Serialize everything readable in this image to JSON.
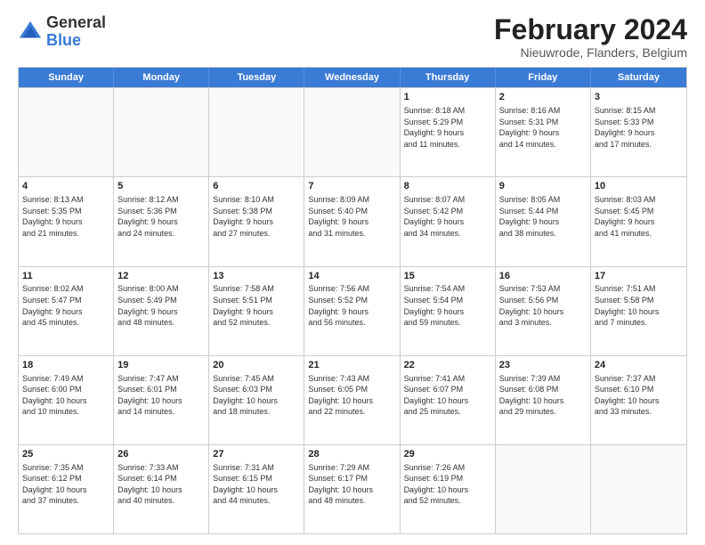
{
  "logo": {
    "general": "General",
    "blue": "Blue"
  },
  "header": {
    "title": "February 2024",
    "location": "Nieuwrode, Flanders, Belgium"
  },
  "days": [
    "Sunday",
    "Monday",
    "Tuesday",
    "Wednesday",
    "Thursday",
    "Friday",
    "Saturday"
  ],
  "weeks": [
    [
      {
        "day": "",
        "text": ""
      },
      {
        "day": "",
        "text": ""
      },
      {
        "day": "",
        "text": ""
      },
      {
        "day": "",
        "text": ""
      },
      {
        "day": "1",
        "text": "Sunrise: 8:18 AM\nSunset: 5:29 PM\nDaylight: 9 hours\nand 11 minutes."
      },
      {
        "day": "2",
        "text": "Sunrise: 8:16 AM\nSunset: 5:31 PM\nDaylight: 9 hours\nand 14 minutes."
      },
      {
        "day": "3",
        "text": "Sunrise: 8:15 AM\nSunset: 5:33 PM\nDaylight: 9 hours\nand 17 minutes."
      }
    ],
    [
      {
        "day": "4",
        "text": "Sunrise: 8:13 AM\nSunset: 5:35 PM\nDaylight: 9 hours\nand 21 minutes."
      },
      {
        "day": "5",
        "text": "Sunrise: 8:12 AM\nSunset: 5:36 PM\nDaylight: 9 hours\nand 24 minutes."
      },
      {
        "day": "6",
        "text": "Sunrise: 8:10 AM\nSunset: 5:38 PM\nDaylight: 9 hours\nand 27 minutes."
      },
      {
        "day": "7",
        "text": "Sunrise: 8:09 AM\nSunset: 5:40 PM\nDaylight: 9 hours\nand 31 minutes."
      },
      {
        "day": "8",
        "text": "Sunrise: 8:07 AM\nSunset: 5:42 PM\nDaylight: 9 hours\nand 34 minutes."
      },
      {
        "day": "9",
        "text": "Sunrise: 8:05 AM\nSunset: 5:44 PM\nDaylight: 9 hours\nand 38 minutes."
      },
      {
        "day": "10",
        "text": "Sunrise: 8:03 AM\nSunset: 5:45 PM\nDaylight: 9 hours\nand 41 minutes."
      }
    ],
    [
      {
        "day": "11",
        "text": "Sunrise: 8:02 AM\nSunset: 5:47 PM\nDaylight: 9 hours\nand 45 minutes."
      },
      {
        "day": "12",
        "text": "Sunrise: 8:00 AM\nSunset: 5:49 PM\nDaylight: 9 hours\nand 48 minutes."
      },
      {
        "day": "13",
        "text": "Sunrise: 7:58 AM\nSunset: 5:51 PM\nDaylight: 9 hours\nand 52 minutes."
      },
      {
        "day": "14",
        "text": "Sunrise: 7:56 AM\nSunset: 5:52 PM\nDaylight: 9 hours\nand 56 minutes."
      },
      {
        "day": "15",
        "text": "Sunrise: 7:54 AM\nSunset: 5:54 PM\nDaylight: 9 hours\nand 59 minutes."
      },
      {
        "day": "16",
        "text": "Sunrise: 7:53 AM\nSunset: 5:56 PM\nDaylight: 10 hours\nand 3 minutes."
      },
      {
        "day": "17",
        "text": "Sunrise: 7:51 AM\nSunset: 5:58 PM\nDaylight: 10 hours\nand 7 minutes."
      }
    ],
    [
      {
        "day": "18",
        "text": "Sunrise: 7:49 AM\nSunset: 6:00 PM\nDaylight: 10 hours\nand 10 minutes."
      },
      {
        "day": "19",
        "text": "Sunrise: 7:47 AM\nSunset: 6:01 PM\nDaylight: 10 hours\nand 14 minutes."
      },
      {
        "day": "20",
        "text": "Sunrise: 7:45 AM\nSunset: 6:03 PM\nDaylight: 10 hours\nand 18 minutes."
      },
      {
        "day": "21",
        "text": "Sunrise: 7:43 AM\nSunset: 6:05 PM\nDaylight: 10 hours\nand 22 minutes."
      },
      {
        "day": "22",
        "text": "Sunrise: 7:41 AM\nSunset: 6:07 PM\nDaylight: 10 hours\nand 25 minutes."
      },
      {
        "day": "23",
        "text": "Sunrise: 7:39 AM\nSunset: 6:08 PM\nDaylight: 10 hours\nand 29 minutes."
      },
      {
        "day": "24",
        "text": "Sunrise: 7:37 AM\nSunset: 6:10 PM\nDaylight: 10 hours\nand 33 minutes."
      }
    ],
    [
      {
        "day": "25",
        "text": "Sunrise: 7:35 AM\nSunset: 6:12 PM\nDaylight: 10 hours\nand 37 minutes."
      },
      {
        "day": "26",
        "text": "Sunrise: 7:33 AM\nSunset: 6:14 PM\nDaylight: 10 hours\nand 40 minutes."
      },
      {
        "day": "27",
        "text": "Sunrise: 7:31 AM\nSunset: 6:15 PM\nDaylight: 10 hours\nand 44 minutes."
      },
      {
        "day": "28",
        "text": "Sunrise: 7:29 AM\nSunset: 6:17 PM\nDaylight: 10 hours\nand 48 minutes."
      },
      {
        "day": "29",
        "text": "Sunrise: 7:26 AM\nSunset: 6:19 PM\nDaylight: 10 hours\nand 52 minutes."
      },
      {
        "day": "",
        "text": ""
      },
      {
        "day": "",
        "text": ""
      }
    ]
  ]
}
